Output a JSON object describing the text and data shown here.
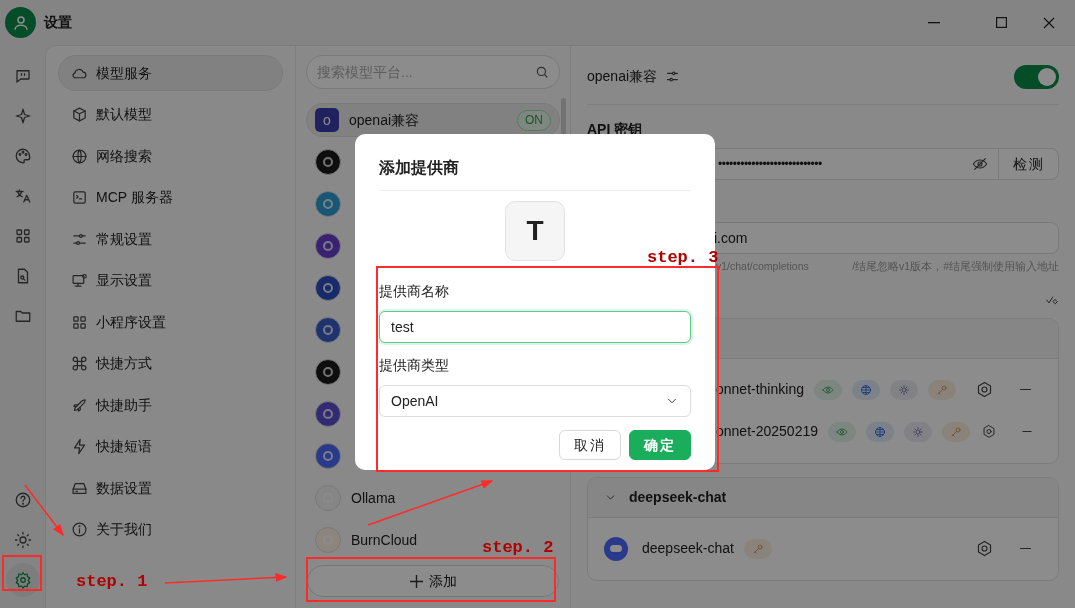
{
  "window": {
    "title": "设置"
  },
  "rail": [
    {
      "selected": false
    },
    {
      "selected": false
    },
    {
      "selected": false
    },
    {
      "selected": false
    },
    {
      "selected": false
    },
    {
      "selected": false
    },
    {
      "selected": false
    }
  ],
  "rail_bottom": [
    {
      "selected": false
    },
    {
      "selected": false
    },
    {
      "selected": true
    }
  ],
  "nav": [
    {
      "label": "模型服务",
      "selected": true
    },
    {
      "label": "默认模型",
      "selected": false
    },
    {
      "label": "网络搜索",
      "selected": false
    },
    {
      "label": "MCP 服务器",
      "selected": false
    },
    {
      "label": "常规设置",
      "selected": false
    },
    {
      "label": "显示设置",
      "selected": false
    },
    {
      "label": "小程序设置",
      "selected": false
    },
    {
      "label": "快捷方式",
      "selected": false
    },
    {
      "label": "快捷助手",
      "selected": false
    },
    {
      "label": "快捷短语",
      "selected": false
    },
    {
      "label": "数据设置",
      "selected": false
    },
    {
      "label": "关于我们",
      "selected": false
    }
  ],
  "providers": {
    "search": {
      "placeholder": "搜索模型平台..."
    },
    "items": [
      {
        "name": "openai兼容",
        "avatar": "o",
        "badge": "ON",
        "selected": true
      },
      {
        "selected": false
      },
      {
        "selected": false
      },
      {
        "selected": false
      },
      {
        "selected": false
      },
      {
        "selected": false
      },
      {
        "selected": false
      },
      {
        "selected": false
      },
      {
        "selected": false
      },
      {
        "name": "Ollama",
        "selected": false
      },
      {
        "name": "BurnCloud",
        "selected": false
      }
    ],
    "add_button": "添加"
  },
  "detail": {
    "title": "openai兼容",
    "enabled": true,
    "api_key": {
      "label": "API 密钥",
      "value": "••••••••••••••••••••••••••••",
      "button": "检测"
    },
    "api_host": {
      "value": "i.com",
      "hint_1": "v1/chat/completions",
      "hint_2": "/结尾忽略v1版本，#结尾强制使用输入地址"
    },
    "model_groups": [
      {
        "models": [
          {
            "name": "onnet-thinking",
            "tags": [
              {
                "kind": "vision"
              },
              {
                "kind": "web"
              },
              {
                "kind": "reasoning"
              },
              {
                "kind": "tools"
              }
            ]
          },
          {
            "name": "onnet-20250219",
            "tags": [
              {
                "kind": "vision"
              },
              {
                "kind": "web"
              },
              {
                "kind": "reasoning"
              },
              {
                "kind": "tools"
              }
            ]
          }
        ]
      },
      {
        "title": "deepseek-chat",
        "expanded": true,
        "models": [
          {
            "name": "deepseek-chat",
            "tags": [
              {
                "kind": "tools"
              }
            ]
          }
        ]
      }
    ]
  },
  "modal": {
    "title": "添加提供商",
    "logo": "T",
    "fields": [
      {
        "label": "提供商名称",
        "kind": "text",
        "value": "test",
        "focused": true
      },
      {
        "label": "提供商类型",
        "kind": "select",
        "value": "OpenAI",
        "focused": false
      }
    ],
    "buttons": [
      {
        "label": "取消",
        "kind": "secondary"
      },
      {
        "label": "确定",
        "kind": "primary"
      }
    ]
  },
  "annotations": {
    "labels": [
      "step. 1",
      "step. 2",
      "step. 3"
    ]
  }
}
